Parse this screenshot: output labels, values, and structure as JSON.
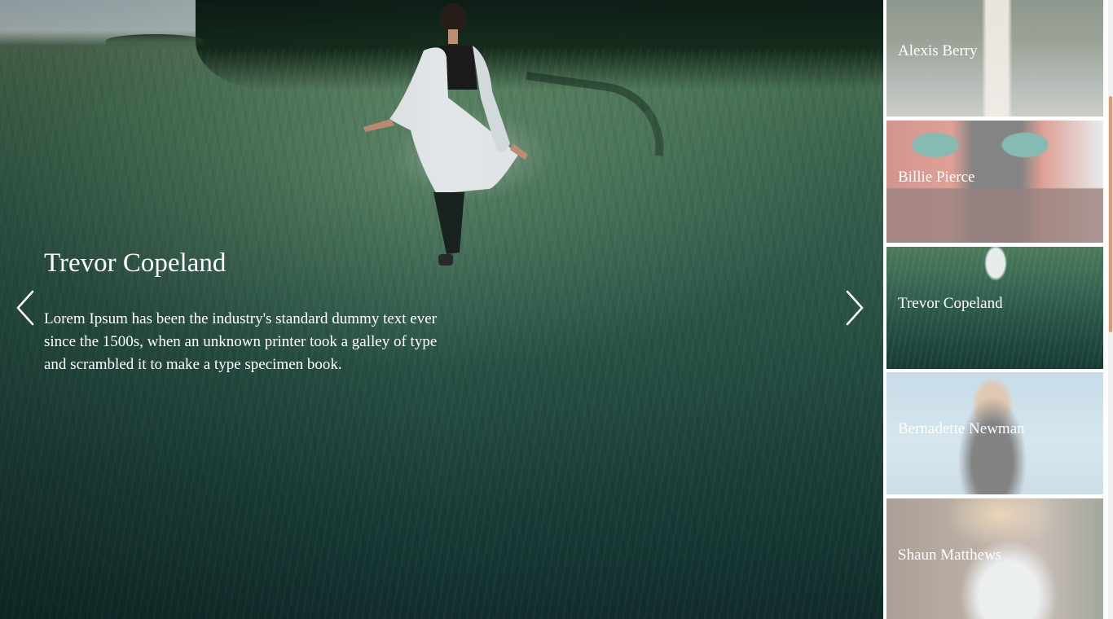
{
  "slider": {
    "active": {
      "title": "Trevor Copeland",
      "description": "Lorem Ipsum has been the industry's standard dummy text ever since the 1500s, when an unknown printer took a galley of type and scrambled it to make a type specimen book."
    },
    "prev_icon": "chevron-left-icon",
    "next_icon": "chevron-right-icon"
  },
  "thumbnails": [
    {
      "name": "Alexis Berry",
      "active": false
    },
    {
      "name": "Billie Pierce",
      "active": false
    },
    {
      "name": "Trevor Copeland",
      "active": true
    },
    {
      "name": "Bernadette Newman",
      "active": false
    },
    {
      "name": "Shaun Matthews",
      "active": false
    }
  ],
  "colors": {
    "caption_text": "#ffffff",
    "scrollbar_thumb": "#e8956b"
  }
}
